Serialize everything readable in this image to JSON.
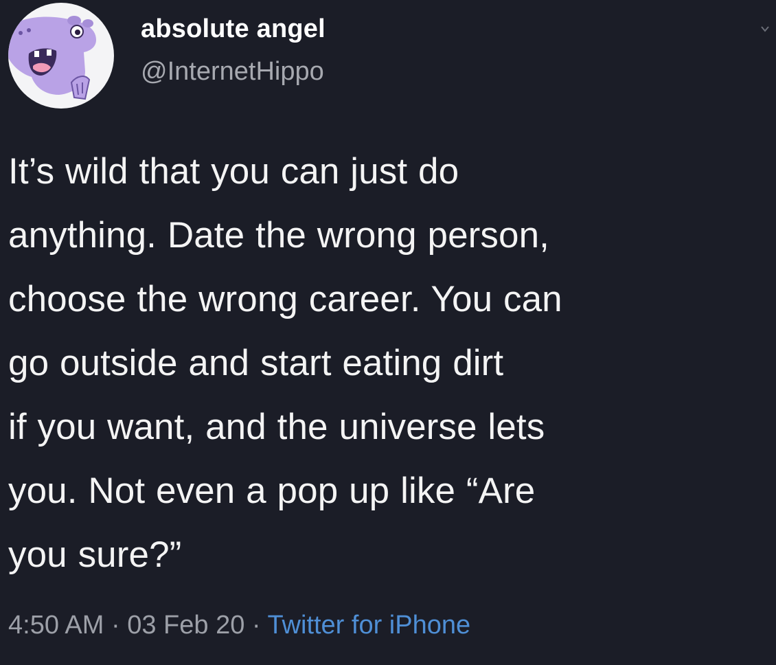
{
  "user": {
    "display_name": "absolute angel",
    "handle": "@InternetHippo",
    "avatar_icon": "hippo-avatar-icon"
  },
  "tweet": {
    "lines": [
      "It’s wild that you can just do",
      "anything. Date the wrong person,",
      "choose the wrong career. You can",
      "go outside and start eating dirt",
      "if you want, and the universe lets",
      "you. Not even a pop up like “Are",
      "you sure?”"
    ]
  },
  "meta": {
    "time": "4:50 AM",
    "separator": " · ",
    "date": "03 Feb 20",
    "source": "Twitter for iPhone"
  },
  "colors": {
    "background": "#1b1d27",
    "text": "#f4f4f4",
    "secondary": "#9da0a8",
    "link": "#4f8fd6",
    "avatar_bg": "#f4f4f6",
    "hippo": "#b9a2e6"
  }
}
